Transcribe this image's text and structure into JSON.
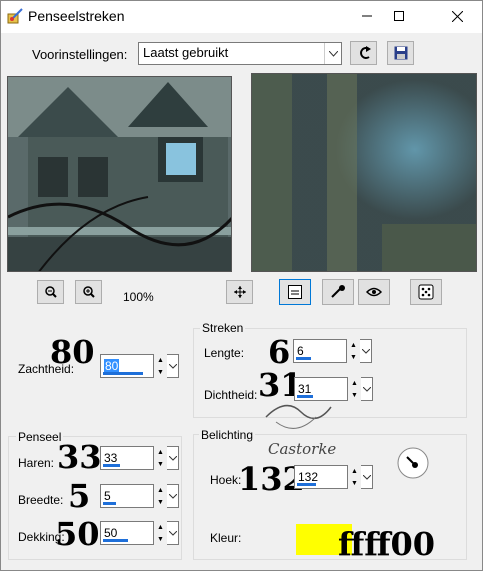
{
  "window": {
    "title": "Penseelstreken"
  },
  "presets": {
    "label": "Voorinstellingen:",
    "selected": "Laatst gebruikt"
  },
  "zoom": {
    "level": "100%"
  },
  "softness": {
    "label": "Zachtheid:",
    "value": "80",
    "overlay": "80",
    "fill": 0.8
  },
  "strokes": {
    "group_label": "Streken",
    "length": {
      "label": "Lengte:",
      "value": "6",
      "overlay": "6",
      "fill": 0.3
    },
    "density": {
      "label": "Dichtheid:",
      "value": "31",
      "overlay": "31",
      "fill": 0.31
    }
  },
  "brush": {
    "group_label": "Penseel",
    "bristles": {
      "label": "Haren:",
      "value": "33",
      "overlay": "33",
      "fill": 0.33
    },
    "width": {
      "label": "Breedte:",
      "value": "5",
      "overlay": "5",
      "fill": 0.25
    },
    "opacity": {
      "label": "Dekking:",
      "value": "50",
      "overlay": "50",
      "fill": 0.5
    }
  },
  "lighting": {
    "group_label": "Belichting",
    "angle": {
      "label": "Hoek:",
      "value": "132",
      "overlay": "132",
      "fill": 0.37
    },
    "color": {
      "label": "Kleur:",
      "hex": "#ffff00",
      "overlay": "ffff00"
    }
  },
  "watermark": {
    "text": "Castorke"
  },
  "icons": [
    "paint-brush-app-icon",
    "minimize-icon",
    "maximize-icon",
    "close-icon",
    "reset-icon",
    "save-icon",
    "zoom-out-icon",
    "zoom-in-icon",
    "move-icon",
    "proof-icon",
    "eyedropper-icon",
    "eye-icon",
    "randomize-dice-icon",
    "angle-dial-icon"
  ]
}
